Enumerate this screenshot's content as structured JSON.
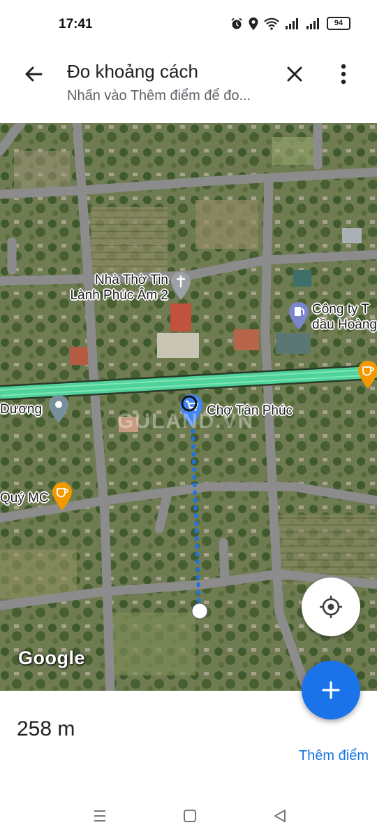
{
  "status_bar": {
    "time": "17:41",
    "battery": "94",
    "icons": [
      "alarm-icon",
      "location-icon",
      "wifi-icon",
      "signal-icon",
      "signal-icon",
      "battery-icon"
    ]
  },
  "header": {
    "title": "Đo khoảng cách",
    "subtitle": "Nhấn vào Thêm điểm để đo...",
    "back_icon": "arrow-back-icon",
    "close_icon": "close-icon",
    "more_icon": "more-vert-icon"
  },
  "map": {
    "places": [
      {
        "name": "Nhà Thờ Tin\nLành Phúc Âm 2",
        "icon": "church-pin-icon"
      },
      {
        "name": "Công ty T\ndầu Hoàng",
        "icon": "gas-station-pin-icon"
      },
      {
        "name": "Dương",
        "icon": "place-pin-icon"
      },
      {
        "name": "Chợ Tân Phúc",
        "icon": "shopping-cart-pin-icon"
      },
      {
        "name": "Quý MC",
        "icon": "cafe-pin-icon"
      },
      {
        "name": "",
        "icon": "cafe-pin-icon"
      }
    ],
    "watermark": "GULAND.VN",
    "logo": "Google",
    "accent_colors": {
      "measure_line": "#1a73e8",
      "highway": "#4fd39a",
      "pin": "#4285f4",
      "cafe_pin": "#f29900"
    }
  },
  "controls": {
    "locate_icon": "my-location-icon",
    "add_icon": "plus-icon"
  },
  "bottom_panel": {
    "distance": "258 m",
    "add_point": "Thêm điểm"
  },
  "nav_bar": {
    "icons": [
      "menu-icon",
      "home-square-icon",
      "back-triangle-icon"
    ]
  }
}
